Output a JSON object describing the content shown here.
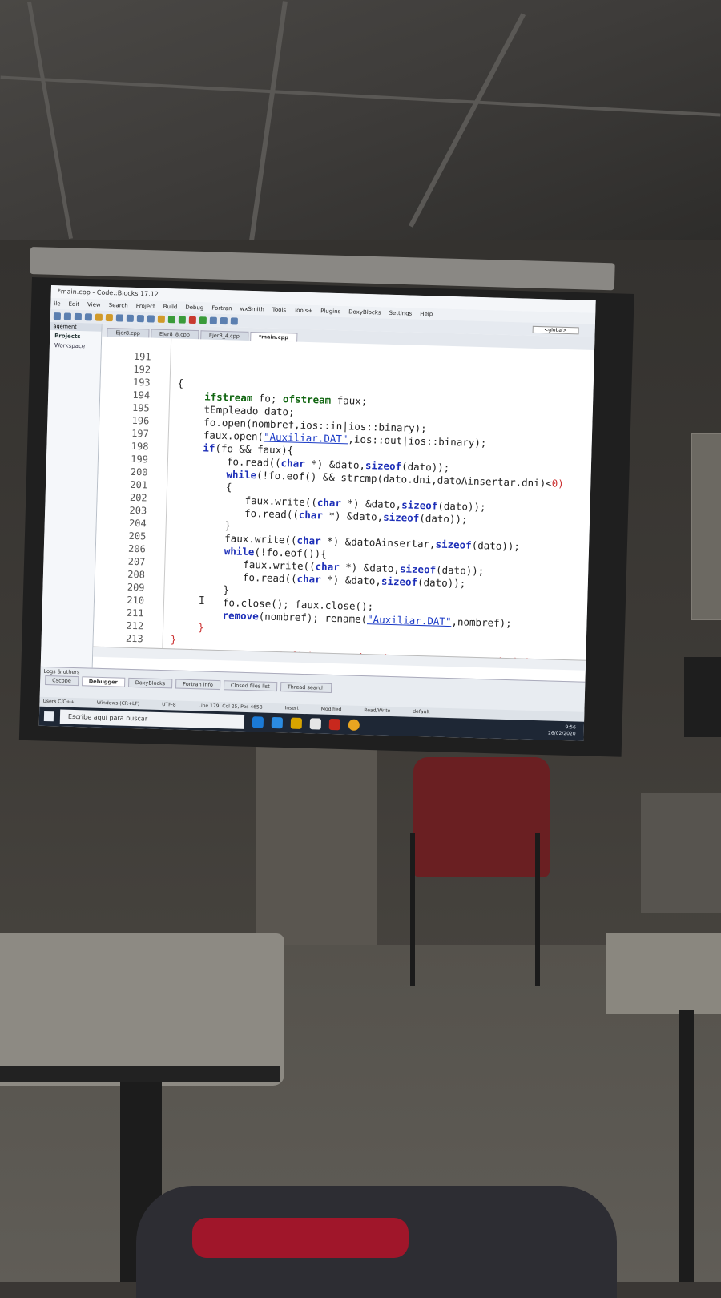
{
  "window": {
    "title": "*main.cpp - Code::Blocks 17.12",
    "menu": [
      "ile",
      "Edit",
      "View",
      "Search",
      "Project",
      "Build",
      "Debug",
      "Fortran",
      "wxSmith",
      "Tools",
      "Tools+",
      "Plugins",
      "DoxyBlocks",
      "Settings",
      "Help"
    ],
    "global_dropdown": "<global>"
  },
  "sidebar": {
    "header": "agement",
    "tab": "Projects",
    "workspace": "Workspace"
  },
  "editor": {
    "tabs": [
      "Ejer8.cpp",
      "Ejer8_8.cpp",
      "Ejer8_4.cpp",
      "*main.cpp"
    ],
    "active_tab": "*main.cpp",
    "line_numbers": [
      "191",
      "192",
      "193",
      "194",
      "195",
      "196",
      "197",
      "198",
      "199",
      "200",
      "201",
      "202",
      "203",
      "204",
      "205",
      "206",
      "207",
      "208",
      "209",
      "210",
      "211",
      "212",
      "213"
    ],
    "code": {
      "l193a": "ifstream",
      "l193b": " fo; ",
      "l193c": "ofstream",
      "l193d": " faux;",
      "l194": "tEmpleado dato;",
      "l195": "fo.open(nombref,ios::in|ios::binary);",
      "l196a": "faux.open(",
      "l196b": "\"Auxiliar.DAT\"",
      "l196c": ",ios::out|ios::binary);",
      "l197a": "if",
      "l197b": "(fo && faux){",
      "l198a": "fo.read((",
      "l198b": "char",
      "l198c": " *) &dato,",
      "l198d": "sizeof",
      "l198e": "(dato));",
      "l199a": "while",
      "l199b": "(!fo.eof() && strcmp(dato.dni,datoAinsertar.dni)<",
      "l199c": "0)",
      "l200": "{",
      "l201a": "faux.write((",
      "l201b": "char",
      "l201c": " *) &dato,",
      "l201d": "sizeof",
      "l201e": "(dato));",
      "l202a": "fo.read((",
      "l202b": "char",
      "l202c": " *) &dato,",
      "l202d": "sizeof",
      "l202e": "(dato));",
      "l203": "}",
      "l204a": "faux.write((",
      "l204b": "char",
      "l204c": " *) &datoAinsertar,",
      "l204d": "sizeof",
      "l204e": "(dato));",
      "l205a": "while",
      "l205b": "(!fo.eof()){",
      "l206a": "faux.write((",
      "l206b": "char",
      "l206c": " *) &dato,",
      "l206d": "sizeof",
      "l206e": "(dato));",
      "l207a": "fo.read((",
      "l207b": "char",
      "l207c": " *) &dato,",
      "l207d": "sizeof",
      "l207e": "(dato));",
      "l208": "}",
      "l209": "fo.close(); faux.close();",
      "l210a": "remove",
      "l210b": "(nombref); rename(",
      "l210c": "\"Auxiliar.DAT\"",
      "l210d": ",nombref);",
      "l211": "}",
      "l212": "}",
      "l213": "/* Suponemos que el fichero está ordenado y que no puede haber i"
    }
  },
  "logs": {
    "header": "Logs & others",
    "tabs": [
      "Cscope",
      "Debugger",
      "DoxyBlocks",
      "Fortran info",
      "Closed files list",
      "Thread search"
    ],
    "active_tab": "Debugger"
  },
  "statusbar": {
    "lang": "Users C/C++",
    "eol": "Windows (CR+LF)",
    "encoding": "UTF-8",
    "position": "Line 179, Col 25, Pos 4658",
    "mode": "Insert",
    "modified": "Modified",
    "rw": "Read/Write",
    "profile": "default"
  },
  "taskbar": {
    "search_placeholder": "Escribe aquí para buscar",
    "time": "9:56",
    "date": "26/02/2020"
  }
}
